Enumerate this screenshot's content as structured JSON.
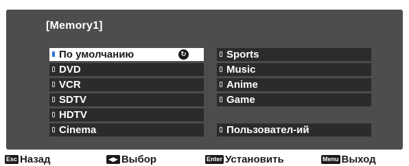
{
  "title": "[Memory1]",
  "left_items": [
    {
      "label": "По умолчанию",
      "selected": true
    },
    {
      "label": "DVD"
    },
    {
      "label": "VCR"
    },
    {
      "label": "SDTV"
    },
    {
      "label": "HDTV"
    },
    {
      "label": "Cinema"
    }
  ],
  "right_items": [
    {
      "label": "Sports"
    },
    {
      "label": "Music"
    },
    {
      "label": "Anime"
    },
    {
      "label": "Game"
    },
    {
      "label": "Пользовател-ий"
    }
  ],
  "footer": {
    "esc_key": "Esc",
    "esc_label": "Назад",
    "arrows_key": "◀▶",
    "arrows_label": "Выбор",
    "enter_key": "Enter",
    "enter_label": "Установить",
    "menu_key": "Menu",
    "menu_label": "Выход"
  },
  "colors": {
    "panel": "#4d4d4d",
    "item_bg": "#2b2b2b",
    "selected_bg": "#ffffff",
    "selected_marker": "#2e6fd6"
  }
}
